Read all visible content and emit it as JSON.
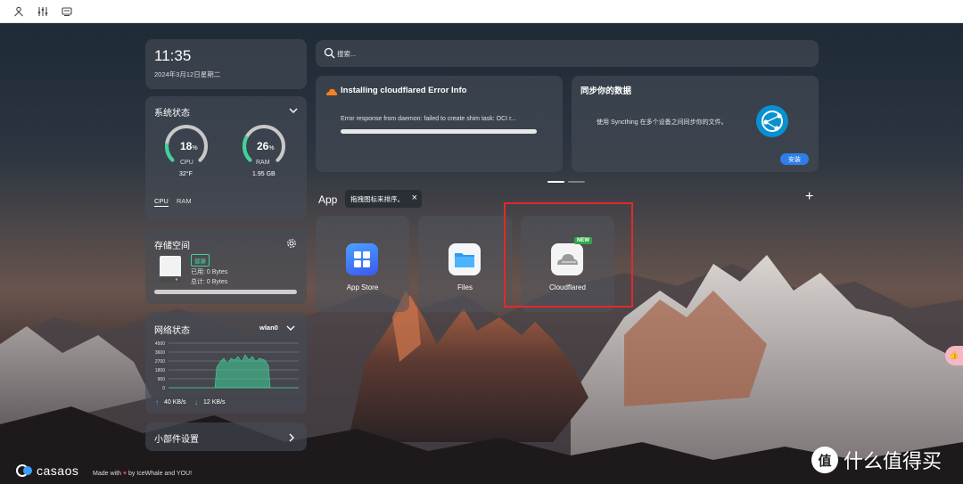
{
  "topbar": {
    "icons": [
      "user-icon",
      "sliders-icon",
      "message-icon"
    ]
  },
  "clock": {
    "time": "11:35",
    "date": "2024年3月12日星期二"
  },
  "system": {
    "title": "系统状态",
    "cpu": {
      "percent": "18",
      "unit": "%",
      "label": "CPU",
      "sub": "32°F",
      "value": 18
    },
    "ram": {
      "percent": "26",
      "unit": "%",
      "label": "RAM",
      "sub": "1.95 GB",
      "value": 26
    },
    "tabs": [
      "CPU",
      "RAM"
    ],
    "accent": "#3fd29a"
  },
  "storage": {
    "title": "存储空间",
    "badge": "健康",
    "used": "已用: 0 Bytes",
    "total": "总计: 0 Bytes"
  },
  "network": {
    "title": "网络状态",
    "iface": "wlan0",
    "ticks": [
      "4500",
      "3600",
      "2700",
      "1800",
      "900",
      "0"
    ],
    "up": "40 KB/s",
    "down": "12 KB/s"
  },
  "widgets": {
    "label": "小部件设置"
  },
  "search": {
    "placeholder": "搜索..."
  },
  "error_card": {
    "title": "Installing cloudflared Error Info",
    "message": "Error response from daemon: failed to create shim task: OCI r..."
  },
  "sync_card": {
    "title": "同步你的数据",
    "text": "使用 Syncthing 在多个设备之间同步你的文件。",
    "button": "安装"
  },
  "apps": {
    "section_label": "App",
    "tooltip": "拖拽图标来排序。",
    "tooltip_close": "×",
    "add": "+",
    "items": [
      {
        "name": "App Store",
        "icon": "app-store-icon"
      },
      {
        "name": "Files",
        "icon": "folder-icon"
      },
      {
        "name": "Cloudflared",
        "icon": "cloudflare-icon",
        "badge": "NEW"
      }
    ]
  },
  "footer": {
    "logo": "casaos",
    "made_prefix": "Made with",
    "made_suffix": "by IceWhale and YOU!"
  },
  "watermark": {
    "text": "什么值得买",
    "logo": "值"
  },
  "side_tab": {
    "text": "👍"
  }
}
